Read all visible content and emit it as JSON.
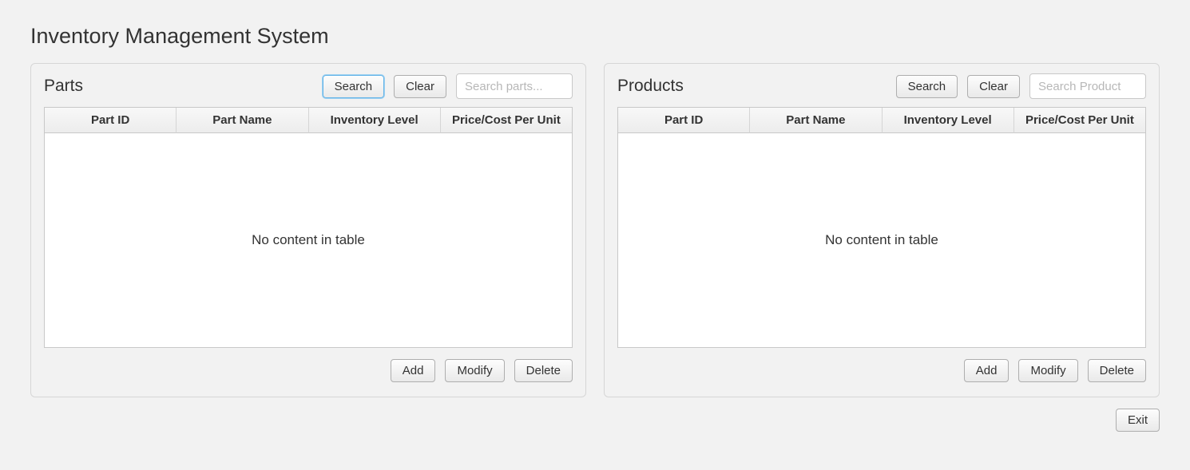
{
  "title": "Inventory Management System",
  "parts": {
    "title": "Parts",
    "search_label": "Search",
    "clear_label": "Clear",
    "search_placeholder": "Search parts...",
    "columns": [
      "Part ID",
      "Part Name",
      "Inventory Level",
      "Price/Cost Per Unit"
    ],
    "rows": [],
    "empty_message": "No content in table",
    "add_label": "Add",
    "modify_label": "Modify",
    "delete_label": "Delete"
  },
  "products": {
    "title": "Products",
    "search_label": "Search",
    "clear_label": "Clear",
    "search_placeholder": "Search Product",
    "columns": [
      "Part ID",
      "Part Name",
      "Inventory Level",
      "Price/Cost Per Unit"
    ],
    "rows": [],
    "empty_message": "No content in table",
    "add_label": "Add",
    "modify_label": "Modify",
    "delete_label": "Delete"
  },
  "exit_label": "Exit"
}
